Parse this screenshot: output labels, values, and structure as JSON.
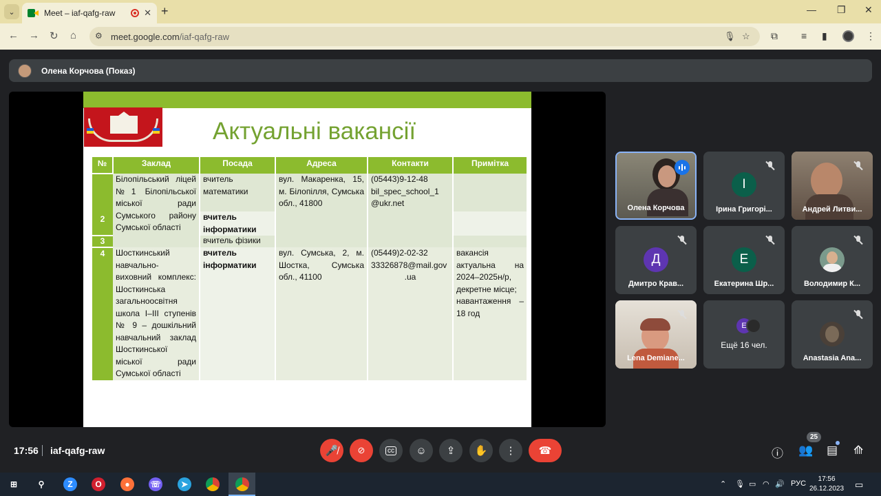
{
  "browser": {
    "tab_title": "Meet – iaf-qafg-raw",
    "url_host": "meet.google.com",
    "url_path": "/iaf-qafg-raw"
  },
  "presenting": {
    "label": "Олена Корчова (Показ)"
  },
  "slide": {
    "title": "Актуальні вакансії",
    "headers": [
      "№",
      "Заклад",
      "Посада",
      "Адреса",
      "Контакти",
      "Примітка"
    ],
    "row1": {
      "num": "1",
      "school_l1": "Білопільський ліцей",
      "school_l2": "№1 Білопільської",
      "school_l3": "міської ради",
      "position": "вчитель математики",
      "address": "вул. Макаренка, 15, м. Білопілля, Сумська обл., 41800",
      "contacts_l1": "(05443)9-12-48",
      "contacts_l2": "bil_spec_school_1",
      "contacts_l3": "@ukr.net",
      "note": ""
    },
    "row2": {
      "num": "2",
      "school_l1": "Сумського району",
      "school_l2": "Сумської області",
      "position": "вчитель інформатики"
    },
    "row3": {
      "num": "3",
      "position": "вчитель фізики"
    },
    "row4": {
      "num": "4",
      "school_lines": [
        "Шосткинський",
        "навчально-",
        "виховний комплекс:",
        "Шосткинська",
        "загальноосвітня",
        "школа I–III ступенів",
        "№ 9 – дошкільний",
        "навчальний заклад",
        "Шосткинської",
        "міської ради",
        "Сумської області"
      ],
      "position": "вчитель інформатики",
      "address": "вул. Сумська, 2, м. Шостка, Сумська обл., 41100",
      "contacts_l1": "(05449)2-02-32",
      "contacts_l2": "33326878@mail.gov",
      "contacts_l3": ".ua",
      "note_lines": [
        "вакансія",
        "актуальна на",
        "2024–2025н/р,",
        "декретне місце;",
        "навантаження –",
        "18 год"
      ]
    }
  },
  "participants": [
    {
      "name": "Олена Корчова",
      "speaking": true
    },
    {
      "name": "Ірина Григорі...",
      "initial": "І",
      "color": "#0b5f4a"
    },
    {
      "name": "Андрей Литви..."
    },
    {
      "name": "Дмитро Крав...",
      "initial": "Д",
      "color": "#5e35b1"
    },
    {
      "name": "Екатерина Шр...",
      "initial": "Е",
      "color": "#0b5f4a"
    },
    {
      "name": "Володимир К..."
    },
    {
      "name": "Lena Demiane..."
    },
    {
      "name": "Ещё 16 чел.",
      "initial": "Е",
      "color": "#5e35b1"
    },
    {
      "name": "Anastasia Ana..."
    }
  ],
  "meeting": {
    "time": "17:56",
    "code": "iaf-qafg-raw",
    "people_count": "25"
  },
  "taskbar": {
    "lang": "РУС",
    "time": "17:56",
    "date": "26.12.2023"
  }
}
